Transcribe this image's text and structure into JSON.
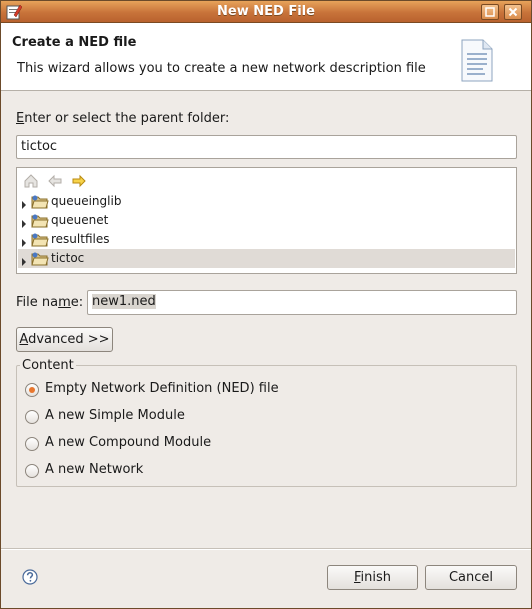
{
  "window": {
    "title": "New NED File"
  },
  "banner": {
    "title": "Create a NED file",
    "description": "This wizard allows you to create a new network description file"
  },
  "parent_folder": {
    "label_accel": "E",
    "label_rest": "nter or select the parent folder:",
    "value": "tictoc"
  },
  "tree": {
    "items": [
      {
        "label": "queueinglib",
        "selected": false
      },
      {
        "label": "queuenet",
        "selected": false
      },
      {
        "label": "resultfiles",
        "selected": false
      },
      {
        "label": "tictoc",
        "selected": true
      }
    ]
  },
  "file_name": {
    "label_pre": "File na",
    "label_accel": "m",
    "label_post": "e:",
    "value": "new1.ned"
  },
  "advanced_button": {
    "accel": "A",
    "rest": "dvanced >>"
  },
  "content": {
    "label": "Content",
    "options": [
      {
        "label": "Empty Network Definition (NED) file",
        "checked": true
      },
      {
        "label": "A new Simple Module",
        "checked": false
      },
      {
        "label": "A new Compound Module",
        "checked": false
      },
      {
        "label": "A new Network",
        "checked": false
      }
    ]
  },
  "footer": {
    "finish_accel": "F",
    "finish_rest": "inish",
    "cancel_label": "Cancel"
  },
  "colors": {
    "titlebar": "#c8733a",
    "radio_accent": "#e8772e",
    "selection": "#e0dbd6"
  },
  "icons": {
    "app": "ned-wizard-icon",
    "maximize": "maximize-icon",
    "close": "close-icon",
    "banner": "document-icon",
    "home": "home-icon",
    "back": "back-arrow-icon",
    "forward": "forward-arrow-icon",
    "folder": "folder-icon",
    "help": "help-icon"
  }
}
